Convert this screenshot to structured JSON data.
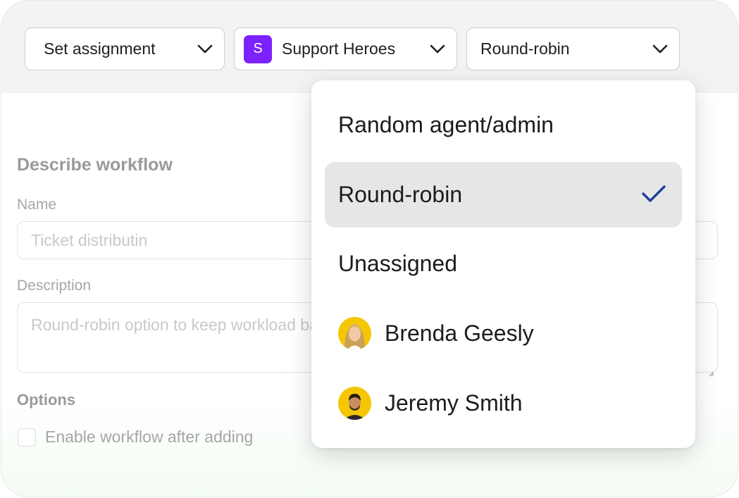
{
  "toolbar": {
    "assignment_select": "Set assignment",
    "team_select": {
      "initial": "S",
      "label": "Support Heroes"
    },
    "method_select": "Round-robin"
  },
  "form": {
    "section_title": "Describe workflow",
    "name_label": "Name",
    "name_placeholder": "Ticket distributin",
    "description_label": "Description",
    "description_placeholder": "Round-robin option to keep workload balanced",
    "options_title": "Options",
    "enable_checkbox_label": "Enable workflow after adding"
  },
  "dropdown": {
    "options": [
      {
        "label": "Random agent/admin",
        "selected": false
      },
      {
        "label": "Round-robin",
        "selected": true
      },
      {
        "label": "Unassigned",
        "selected": false
      },
      {
        "label": "Brenda Geesly",
        "avatar": "woman-avatar"
      },
      {
        "label": "Jeremy Smith",
        "avatar": "man-avatar"
      }
    ]
  },
  "colors": {
    "team_badge": "#7c22ff",
    "checkmark": "#1d3f99",
    "avatar_bg": "#f6c700",
    "selected_row": "#e6e6e6"
  }
}
